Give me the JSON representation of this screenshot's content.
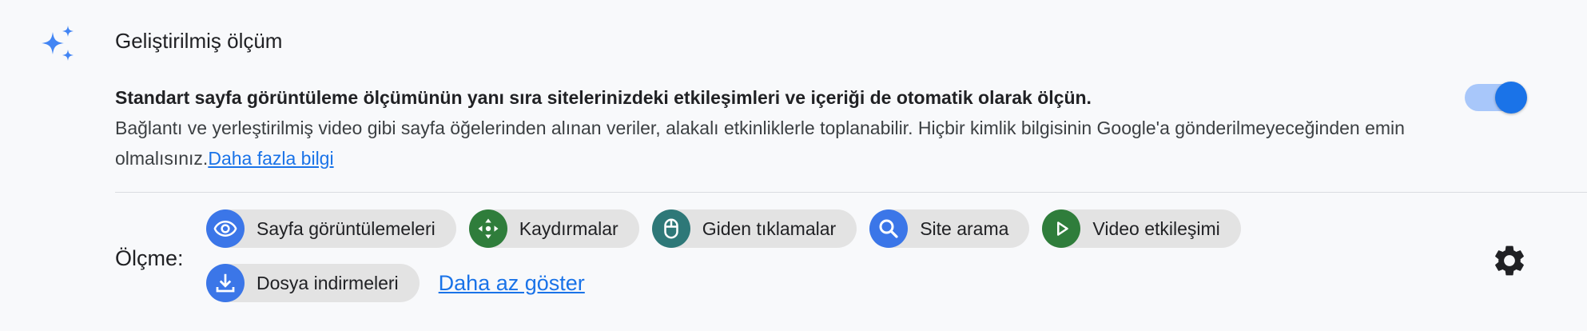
{
  "section": {
    "title": "Geliştirilmiş ölçüm",
    "description_bold": "Standart sayfa görüntüleme ölçümünün yanı sıra sitelerinizdeki etkileşimleri ve içeriği de otomatik olarak ölçün.",
    "description": "Bağlantı ve yerleştirilmiş video gibi sayfa öğelerinden alınan veriler, alakalı etkinliklerle toplanabilir. Hiçbir kimlik bilgisinin Google'a gönderilmeyeceğinden emin olmalısınız.",
    "learn_more": "Daha fazla bilgi",
    "toggle_on": true
  },
  "measure": {
    "label": "Ölçme:",
    "chips": [
      {
        "label": "Sayfa görüntülemeleri",
        "icon": "eye-icon",
        "color": "#3b76e8"
      },
      {
        "label": "Kaydırmalar",
        "icon": "scroll-arrows-icon",
        "color": "#2f7d3b"
      },
      {
        "label": "Giden tıklamalar",
        "icon": "mouse-icon",
        "color": "#2e7878"
      },
      {
        "label": "Site arama",
        "icon": "search-icon",
        "color": "#3b76e8"
      },
      {
        "label": "Video etkileşimi",
        "icon": "play-icon",
        "color": "#2f7d3b"
      },
      {
        "label": "Dosya indirmeleri",
        "icon": "download-icon",
        "color": "#3b76e8"
      }
    ],
    "show_less": "Daha az göster"
  },
  "colors": {
    "accent": "#1a73e8",
    "toggle_track": "#a8c7fa",
    "chip_bg": "#e3e3e3"
  }
}
